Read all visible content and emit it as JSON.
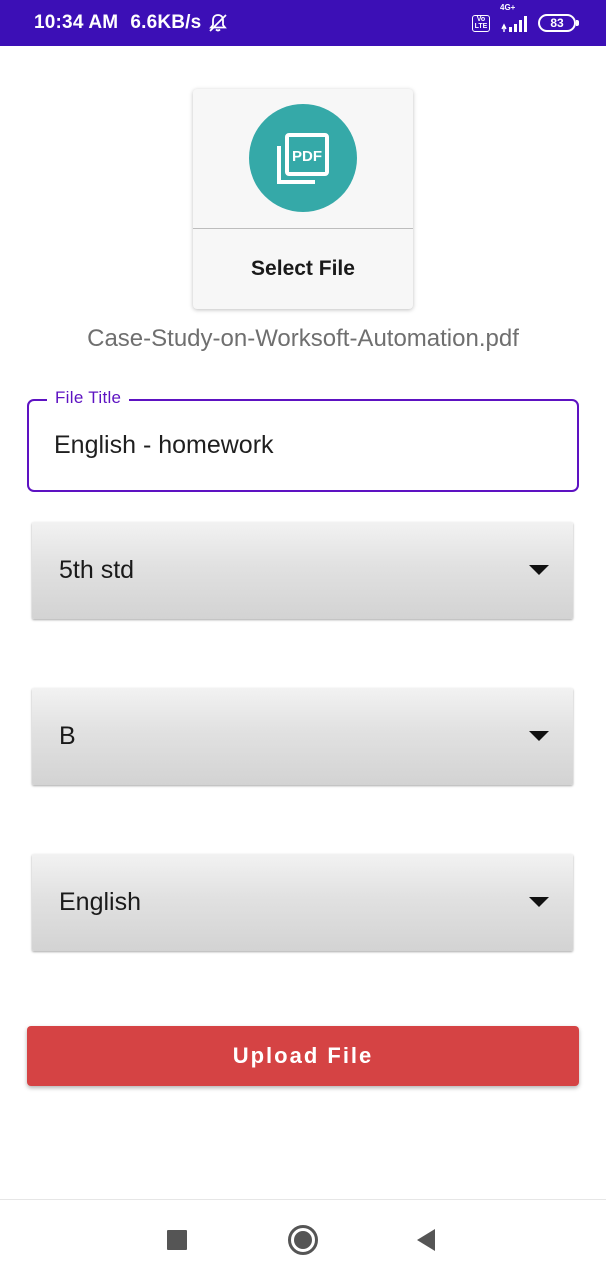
{
  "status_bar": {
    "time": "10:34 AM",
    "network_speed": "6.6KB/s",
    "network_type": "4G+",
    "volte": [
      "Vo",
      "LTE"
    ],
    "battery": "83",
    "background_color": "#3c0fb6"
  },
  "file_picker": {
    "icon": "pdf-icon",
    "icon_text": "PDF",
    "icon_color": "#35a9a8",
    "label": "Select File"
  },
  "selected_file": "Case-Study-on-Worksoft-Automation.pdf",
  "title_field": {
    "label": "File Title",
    "value": "English - homework",
    "accent_color": "#5d12c2"
  },
  "dropdowns": [
    {
      "selected": "5th std"
    },
    {
      "selected": "B"
    },
    {
      "selected": "English"
    }
  ],
  "upload_button": {
    "label": "Upload File",
    "color": "#d54344"
  },
  "nav_bar": {
    "buttons": [
      "recents-square-icon",
      "home-circle-icon",
      "back-triangle-icon"
    ]
  }
}
